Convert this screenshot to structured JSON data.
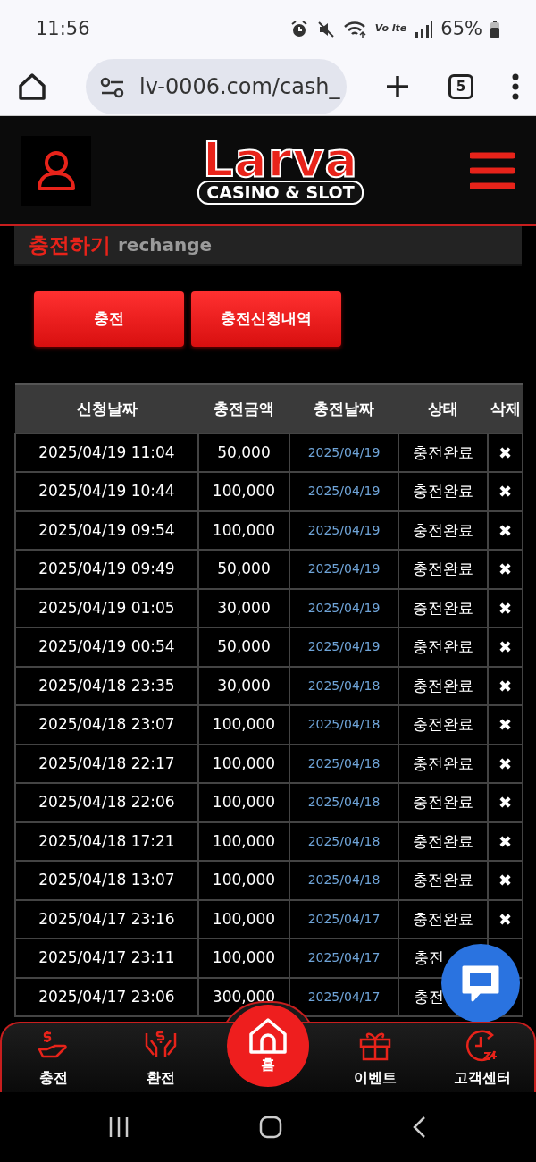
{
  "status_bar": {
    "time": "11:56",
    "network": "Vo lte",
    "battery": "65%"
  },
  "browser": {
    "url": "lv-0006.com/cash_",
    "tab_count": "5"
  },
  "header": {
    "logo": "Larva",
    "logo_sub": "CASINO & SLOT"
  },
  "section": {
    "title": "충전하기",
    "subtitle": "rechange"
  },
  "buttons": [
    {
      "label": "충전"
    },
    {
      "label": "충전신청내역"
    }
  ],
  "table": {
    "columns": [
      "신청날짜",
      "충전금액",
      "충전날짜",
      "상태",
      "삭제"
    ],
    "rows": [
      {
        "requested": "2025/04/19 11:04",
        "amount": "50,000",
        "charged": "2025/04/19",
        "status": "충전완료",
        "delete": "✖"
      },
      {
        "requested": "2025/04/19 10:44",
        "amount": "100,000",
        "charged": "2025/04/19",
        "status": "충전완료",
        "delete": "✖"
      },
      {
        "requested": "2025/04/19 09:54",
        "amount": "100,000",
        "charged": "2025/04/19",
        "status": "충전완료",
        "delete": "✖"
      },
      {
        "requested": "2025/04/19 09:49",
        "amount": "50,000",
        "charged": "2025/04/19",
        "status": "충전완료",
        "delete": "✖"
      },
      {
        "requested": "2025/04/19 01:05",
        "amount": "30,000",
        "charged": "2025/04/19",
        "status": "충전완료",
        "delete": "✖"
      },
      {
        "requested": "2025/04/19 00:54",
        "amount": "50,000",
        "charged": "2025/04/19",
        "status": "충전완료",
        "delete": "✖"
      },
      {
        "requested": "2025/04/18 23:35",
        "amount": "30,000",
        "charged": "2025/04/18",
        "status": "충전완료",
        "delete": "✖"
      },
      {
        "requested": "2025/04/18 23:07",
        "amount": "100,000",
        "charged": "2025/04/18",
        "status": "충전완료",
        "delete": "✖"
      },
      {
        "requested": "2025/04/18 22:17",
        "amount": "100,000",
        "charged": "2025/04/18",
        "status": "충전완료",
        "delete": "✖"
      },
      {
        "requested": "2025/04/18 22:06",
        "amount": "100,000",
        "charged": "2025/04/18",
        "status": "충전완료",
        "delete": "✖"
      },
      {
        "requested": "2025/04/18 17:21",
        "amount": "100,000",
        "charged": "2025/04/18",
        "status": "충전완료",
        "delete": "✖"
      },
      {
        "requested": "2025/04/18 13:07",
        "amount": "100,000",
        "charged": "2025/04/18",
        "status": "충전완료",
        "delete": "✖"
      },
      {
        "requested": "2025/04/17 23:16",
        "amount": "100,000",
        "charged": "2025/04/17",
        "status": "충전완료",
        "delete": "✖"
      },
      {
        "requested": "2025/04/17 23:11",
        "amount": "100,000",
        "charged": "2025/04/17",
        "status": "충전"
      },
      {
        "requested": "2025/04/17 23:06",
        "amount": "300,000",
        "charged": "2025/04/17",
        "status": "충전"
      }
    ]
  },
  "bottom_nav": [
    {
      "label": "충전",
      "kind": "side"
    },
    {
      "label": "환전",
      "kind": "side"
    },
    {
      "label": "홈",
      "kind": "center"
    },
    {
      "label": "이벤트",
      "kind": "side"
    },
    {
      "label": "고객센터",
      "kind": "side"
    }
  ]
}
